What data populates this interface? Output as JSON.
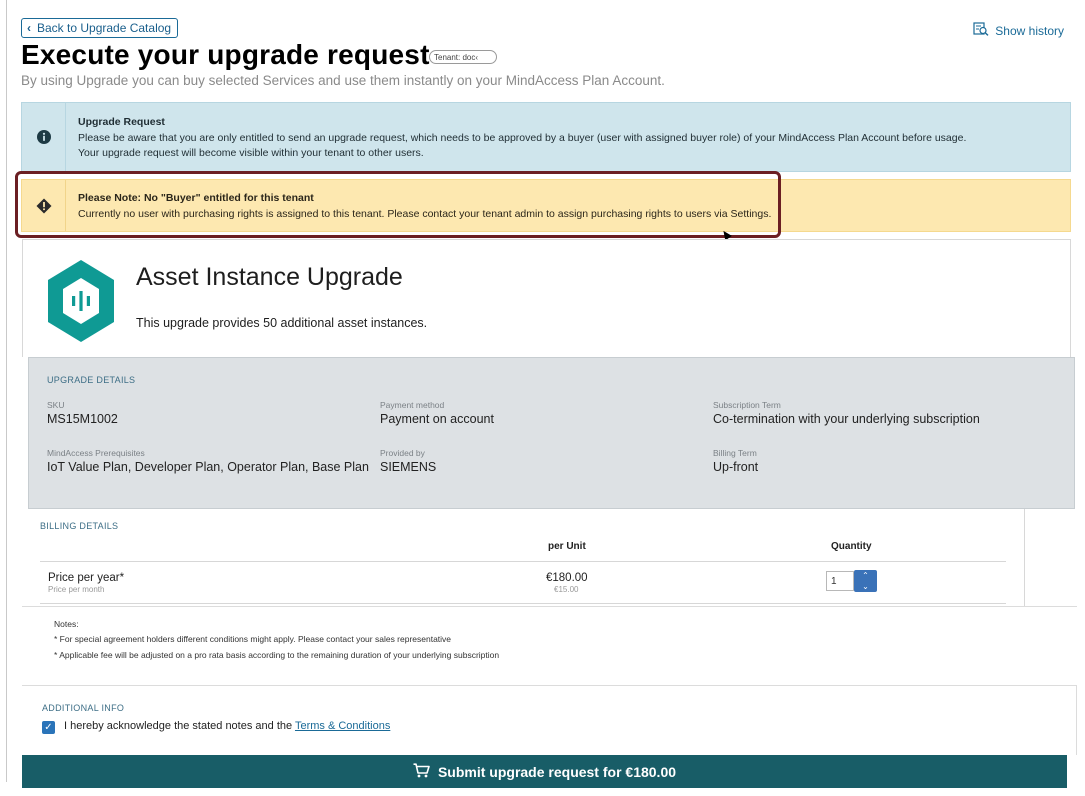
{
  "nav": {
    "back_label": "Back to Upgrade Catalog",
    "history_label": "Show history"
  },
  "header": {
    "title": "Execute your upgrade request",
    "tenant_badge": "Tenant: doc‹",
    "subtitle": "By using Upgrade you can buy selected Services and use them instantly on your MindAccess Plan Account."
  },
  "banners": {
    "info": {
      "title": "Upgrade Request",
      "line1": "Please be aware that you are only entitled to send an upgrade request, which needs to be approved by a buyer (user with assigned buyer role) of your MindAccess Plan Account before usage.",
      "line2": "Your upgrade request will become visible within your tenant to other users."
    },
    "warning": {
      "title": "Please Note: No \"Buyer\" entitled for this tenant",
      "line1": "Currently no user with purchasing rights is assigned to this tenant. Please contact your tenant admin to assign purchasing rights to users via Settings."
    }
  },
  "product": {
    "name": "Asset Instance Upgrade",
    "description": "This upgrade provides 50 additional asset instances."
  },
  "upgrade_details": {
    "section_label": "UPGRADE DETAILS",
    "sku_label": "SKU",
    "sku": "MS15M1002",
    "payment_label": "Payment method",
    "payment": "Payment on account",
    "subscription_label": "Subscription Term",
    "subscription": "Co-termination with your underlying subscription",
    "prereq_label": "MindAccess Prerequisites",
    "prereq": "IoT Value Plan, Developer Plan, Operator Plan, Base Plan",
    "provider_label": "Provided by",
    "provider": "SIEMENS",
    "billing_term_label": "Billing Term",
    "billing_term": "Up-front"
  },
  "billing": {
    "section_label": "BILLING DETAILS",
    "col_per_unit": "per Unit",
    "col_quantity": "Quantity",
    "row_label": "Price per year*",
    "row_sublabel": "Price per month",
    "price_year": "€180.00",
    "price_month": "€15.00",
    "quantity": "1"
  },
  "notes": {
    "title": "Notes:",
    "note1": "* For special agreement holders different conditions might apply. Please contact your sales representative",
    "note2": "* Applicable fee will be adjusted on a pro rata basis according to the remaining duration of your underlying subscription"
  },
  "additional": {
    "section_label": "ADDITIONAL INFO",
    "ack_text": "I hereby acknowledge the stated notes and the ",
    "terms_link": "Terms & Conditions",
    "checked": true
  },
  "submit": {
    "label": "Submit upgrade request for €180.00"
  },
  "colors": {
    "accent": "#1a6a97",
    "info_bg": "#cfe5ec",
    "warning_bg": "#fde8b0",
    "highlight": "#6b1f23",
    "details_bg": "#dde1e4",
    "submit_bg": "#185d67",
    "logo": "#0f9a94"
  }
}
